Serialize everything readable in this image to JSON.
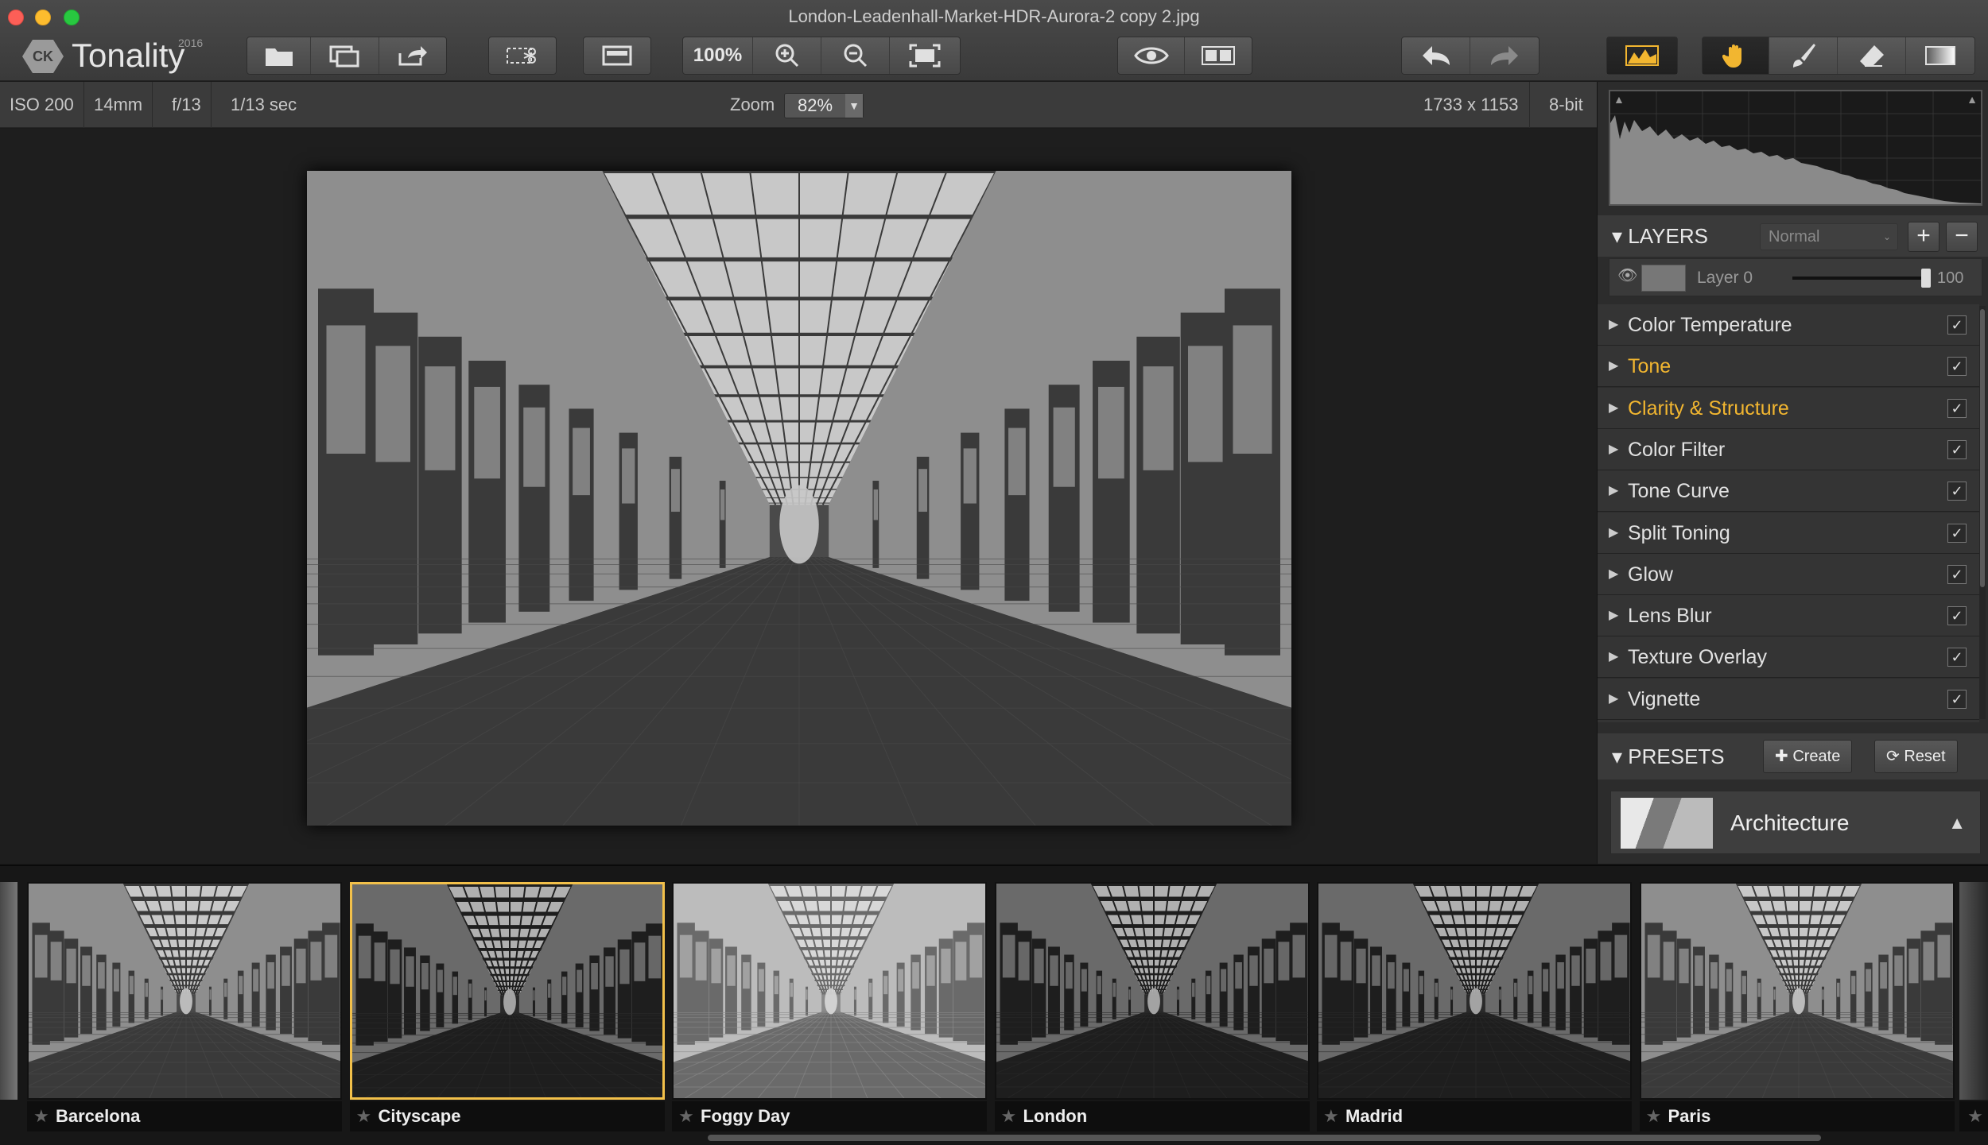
{
  "window": {
    "title": "London-Leadenhall-Market-HDR-Aurora-2 copy 2.jpg"
  },
  "app": {
    "logo_badge": "CK",
    "name": "Tonality",
    "year": "2016"
  },
  "toolbar": {
    "zoom_100_label": "100%",
    "icons": [
      "open-folder-icon",
      "batch-icon",
      "export-icon",
      "crop-icon",
      "single-view-icon",
      "zoom-in-icon",
      "zoom-out-icon",
      "fit-screen-icon",
      "preview-eye-icon",
      "split-view-icon",
      "undo-icon",
      "redo-icon",
      "histogram-icon",
      "hand-tool-icon",
      "brush-icon",
      "eraser-icon",
      "gradient-icon"
    ],
    "accent_color": "#f2b630"
  },
  "infobar": {
    "iso": "ISO 200",
    "focal": "14mm",
    "aperture": "f/13",
    "shutter": "1/13 sec",
    "zoom_label": "Zoom",
    "zoom_value": "82%",
    "dimensions": "1733 x 1153",
    "bit_depth": "8-bit"
  },
  "layers": {
    "title": "LAYERS",
    "blend_mode": "Normal",
    "add_label": "+",
    "remove_label": "−",
    "layer_name": "Layer 0",
    "opacity": "100",
    "opacity_fraction": 1.0
  },
  "adjustments": [
    {
      "name": "Color Temperature",
      "highlighted": false,
      "enabled": true
    },
    {
      "name": "Tone",
      "highlighted": true,
      "enabled": true
    },
    {
      "name": "Clarity & Structure",
      "highlighted": true,
      "enabled": true
    },
    {
      "name": "Color Filter",
      "highlighted": false,
      "enabled": true
    },
    {
      "name": "Tone Curve",
      "highlighted": false,
      "enabled": true
    },
    {
      "name": "Split Toning",
      "highlighted": false,
      "enabled": true
    },
    {
      "name": "Glow",
      "highlighted": false,
      "enabled": true
    },
    {
      "name": "Lens Blur",
      "highlighted": false,
      "enabled": true
    },
    {
      "name": "Texture Overlay",
      "highlighted": false,
      "enabled": true
    },
    {
      "name": "Vignette",
      "highlighted": false,
      "enabled": true
    }
  ],
  "presets": {
    "title": "PRESETS",
    "create_label": "Create",
    "reset_label": "Reset",
    "category": "Architecture"
  },
  "filmstrip": [
    {
      "name": "Barcelona",
      "selected": false,
      "tone": "mid"
    },
    {
      "name": "Cityscape",
      "selected": true,
      "tone": "dark"
    },
    {
      "name": "Foggy Day",
      "selected": false,
      "tone": "light"
    },
    {
      "name": "London",
      "selected": false,
      "tone": "dark"
    },
    {
      "name": "Madrid",
      "selected": false,
      "tone": "dark"
    },
    {
      "name": "Paris",
      "selected": false,
      "tone": "mid"
    }
  ]
}
